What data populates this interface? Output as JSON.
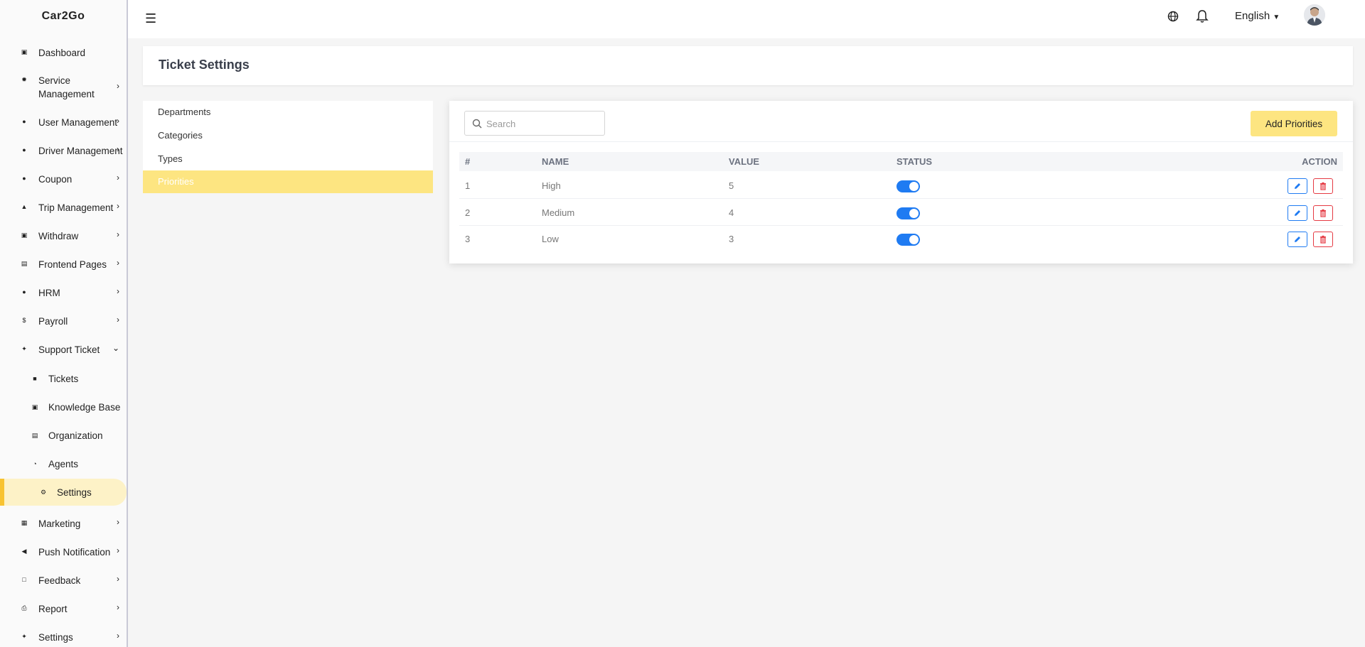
{
  "app": {
    "brand": "Car2Go"
  },
  "topbar": {
    "language": "English",
    "globe_icon": "globe-icon",
    "bell_icon": "bell-icon",
    "menu_icon": "hamburger-icon"
  },
  "sidebar": {
    "items": [
      {
        "label": "Dashboard",
        "icon": "laptop-icon",
        "chevron": false
      },
      {
        "label": "Service Management",
        "icon": "gear-icon",
        "chevron": true
      },
      {
        "label": "User Management",
        "icon": "users-icon",
        "chevron": true
      },
      {
        "label": "Driver Management",
        "icon": "user-icon",
        "chevron": true
      },
      {
        "label": "Coupon",
        "icon": "coupon-icon",
        "chevron": true
      },
      {
        "label": "Trip Management",
        "icon": "car-icon",
        "chevron": true
      },
      {
        "label": "Withdraw",
        "icon": "money-icon",
        "chevron": true
      },
      {
        "label": "Frontend Pages",
        "icon": "pages-icon",
        "chevron": true
      },
      {
        "label": "HRM",
        "icon": "users-icon",
        "chevron": true
      },
      {
        "label": "Payroll",
        "icon": "dollar-icon",
        "chevron": true
      },
      {
        "label": "Support Ticket",
        "icon": "wrench-icon",
        "chevron": "down"
      }
    ],
    "support_sub": [
      {
        "label": "Tickets",
        "icon": "ticket-icon"
      },
      {
        "label": "Knowledge Base",
        "icon": "book-icon"
      },
      {
        "label": "Organization",
        "icon": "building-icon"
      },
      {
        "label": "Agents",
        "icon": "headset-icon"
      },
      {
        "label": "Settings",
        "icon": "settings-icon",
        "active": true
      }
    ],
    "items_after": [
      {
        "label": "Marketing",
        "icon": "grid-icon"
      },
      {
        "label": "Push Notification",
        "icon": "megaphone-icon"
      },
      {
        "label": "Feedback",
        "icon": "feedback-icon"
      },
      {
        "label": "Report",
        "icon": "print-icon"
      },
      {
        "label": "Settings",
        "icon": "wrench-icon"
      }
    ]
  },
  "page": {
    "title": "Ticket Settings"
  },
  "settings_menu": {
    "items": [
      "Departments",
      "Categories",
      "Types",
      "Priorities"
    ],
    "active": "Priorities"
  },
  "table": {
    "search_placeholder": "Search",
    "add_button": "Add Priorities",
    "columns": [
      "#",
      "NAME",
      "VALUE",
      "STATUS",
      "ACTION"
    ],
    "rows": [
      {
        "index": "1",
        "name": "High",
        "value": "5",
        "status": true
      },
      {
        "index": "2",
        "name": "Medium",
        "value": "4",
        "status": true
      },
      {
        "index": "3",
        "name": "Low",
        "value": "3",
        "status": true
      }
    ]
  },
  "colors": {
    "accent_yellow": "#fde581",
    "active_bar": "#f8c331",
    "primary_blue": "#1f7bf2",
    "danger_red": "#e53a43"
  }
}
